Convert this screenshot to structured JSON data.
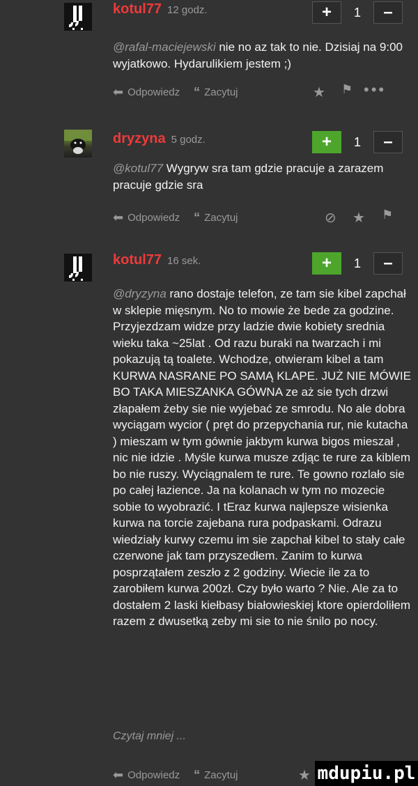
{
  "comments": [
    {
      "user": "kotul77",
      "time": "12 godz.",
      "vote_plus": "+",
      "vote_count": "1",
      "vote_minus": "–",
      "mention": "@rafal-maciejewski",
      "text": " nie no az tak to nie. Dzisiaj na 9:00 wyjatkowo. Hydarulikiem jestem ;)",
      "reply": "Odpowiedz",
      "quote": "Zacytuj",
      "plus_green": false
    },
    {
      "user": "dryzyna",
      "time": "5 godz.",
      "vote_plus": "+",
      "vote_count": "1",
      "vote_minus": "–",
      "mention": "@kotul77",
      "text": " Wygryw sra tam gdzie pracuje a zarazem pracuje gdzie sra",
      "reply": "Odpowiedz",
      "quote": "Zacytuj",
      "plus_green": true
    },
    {
      "user": "kotul77",
      "time": "16 sek.",
      "vote_plus": "+",
      "vote_count": "1",
      "vote_minus": "–",
      "mention": "@dryzyna",
      "text": " rano dostaje telefon, ze tam sie kibel zapchał w sklepie mięsnym. No to mowie że bede za godzine. Przyjezdzam widze przy ladzie dwie kobiety srednia wieku taka ~25lat . Od razu buraki na twarzach i mi pokazują tą toalete. Wchodze, otwieram kibel a tam KURWA NASRANE PO SAMĄ KLAPE. JUŻ NIE MÓWIE BO TAKA MIESZANKA GÓWNA ze aż sie tych drzwi złapałem żeby sie nie wyjebać ze smrodu. No ale dobra wyciągam wycior ( pręt do przepychania rur, nie kutacha ) mieszam w tym gównie jakbym kurwa bigos mieszał , nic nie idzie . Myśle kurwa musze zdjąc te rure za kiblem bo nie ruszy. Wyciągnalem te rure. Te gowno rozlało sie po całej łazience. Ja na kolanach w tym no mozecie sobie to wyobrazić. I tEraz kurwa najlepsze wisienka kurwa na torcie zajebana rura podpaskami. Odrazu wiedziały kurwy czemu im sie zapchał kibel to stały całe czerwone jak tam przyszedłem. Zanim to kurwa posprzątałem zeszło z 2 godziny. Wiecie ile za to zarobiłem kurwa 200zł. Czy było warto ? Nie. Ale za to dostałem 2 laski kiełbasy białowieskiej ktore opierdoliłem razem z dwusetką zeby mi sie to nie śnilo po nocy.",
      "read_more": "Czytaj mniej ...",
      "reply": "Odpowiedz",
      "quote": "Zacytuj",
      "plus_green": true
    }
  ],
  "icons": {
    "reply": "reply-arrow-icon",
    "quote": "quote-icon",
    "star": "star-icon",
    "flag": "flag-icon",
    "more": "more-dots-icon",
    "block": "block-icon"
  },
  "colors": {
    "background": "#333333",
    "username": "#ef3a3a",
    "plus_active": "#4ea52c",
    "muted": "#9a9a9a"
  },
  "watermark": "mdupiu.pl"
}
